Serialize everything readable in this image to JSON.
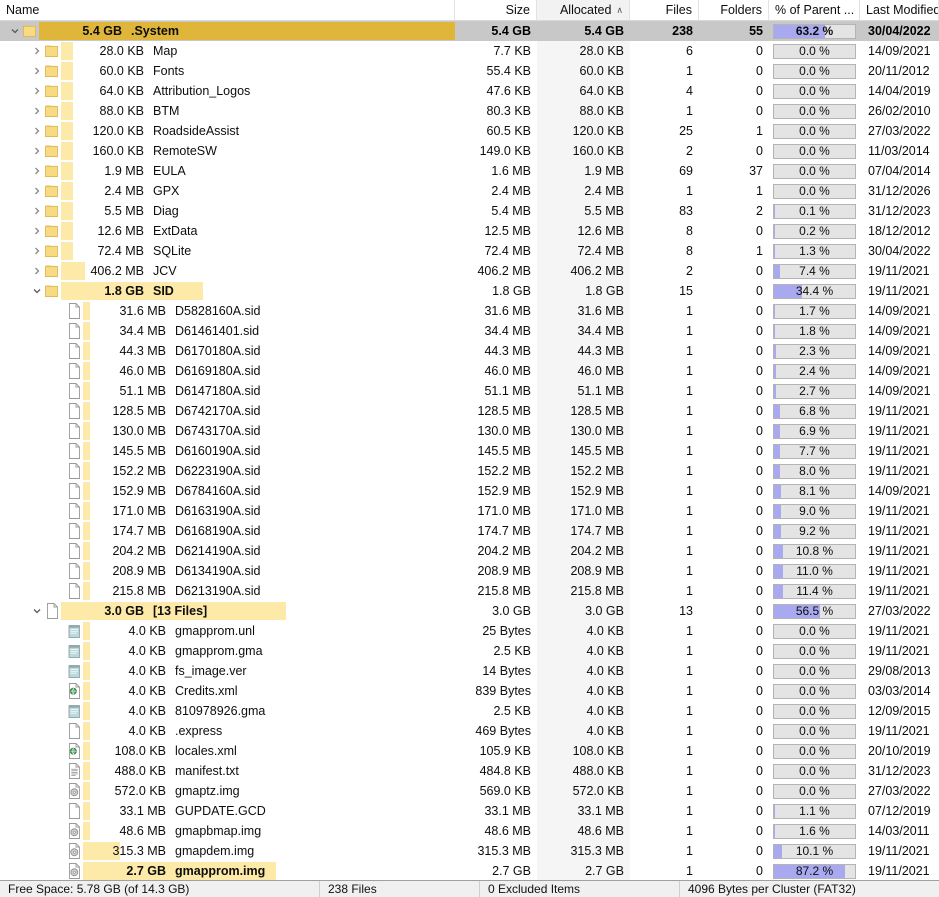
{
  "columns": {
    "name": "Name",
    "size": "Size",
    "allocated": "Allocated",
    "allocated_sort_glyph": "∧",
    "files": "Files",
    "folders": "Folders",
    "percent_of_parent": "% of Parent ...",
    "last_modified": "Last Modified"
  },
  "colors": {
    "size_bar": "#fde9a8",
    "size_bar_selected": "#dfb53a",
    "percent_fill": "#a9a9f0",
    "percent_track": "#e4e4e4",
    "selected_row": "#c8c8c8",
    "folder_icon": "#f6d776",
    "sorted_column": "#f5f5f5"
  },
  "status_bar": [
    "Free Space:  5.78 GB  (of 14.3 GB)",
    "238  Files",
    "0  Excluded Items",
    "4096  Bytes per Cluster  (FAT32)"
  ],
  "rows": [
    {
      "twisty": "expanded",
      "icon": "folder",
      "size_label": "5.4 GB",
      "name": ".System",
      "bar_pct": 100,
      "selected": true,
      "bold": true,
      "size": "5.4 GB",
      "allocated": "5.4 GB",
      "files": "238",
      "folders": "55",
      "percent": "63.2 %",
      "percent_value": 63.2,
      "modified": "30/04/2022",
      "depth": 0
    },
    {
      "twisty": "collapsed",
      "icon": "folder",
      "size_label": "28.0 KB",
      "name": "Map",
      "bar_pct": 3,
      "selected": false,
      "bold": false,
      "size": "7.7 KB",
      "allocated": "28.0 KB",
      "files": "6",
      "folders": "0",
      "percent": "0.0 %",
      "percent_value": 0.0,
      "modified": "14/09/2021",
      "depth": 1
    },
    {
      "twisty": "collapsed",
      "icon": "folder",
      "size_label": "60.0 KB",
      "name": "Fonts",
      "bar_pct": 3,
      "selected": false,
      "bold": false,
      "size": "55.4 KB",
      "allocated": "60.0 KB",
      "files": "1",
      "folders": "0",
      "percent": "0.0 %",
      "percent_value": 0.0,
      "modified": "20/11/2012",
      "depth": 1
    },
    {
      "twisty": "collapsed",
      "icon": "folder",
      "size_label": "64.0 KB",
      "name": "Attribution_Logos",
      "bar_pct": 3,
      "selected": false,
      "bold": false,
      "size": "47.6 KB",
      "allocated": "64.0 KB",
      "files": "4",
      "folders": "0",
      "percent": "0.0 %",
      "percent_value": 0.0,
      "modified": "14/04/2019",
      "depth": 1
    },
    {
      "twisty": "collapsed",
      "icon": "folder",
      "size_label": "88.0 KB",
      "name": "BTM",
      "bar_pct": 3,
      "selected": false,
      "bold": false,
      "size": "80.3 KB",
      "allocated": "88.0 KB",
      "files": "1",
      "folders": "0",
      "percent": "0.0 %",
      "percent_value": 0.0,
      "modified": "26/02/2010",
      "depth": 1
    },
    {
      "twisty": "collapsed",
      "icon": "folder",
      "size_label": "120.0 KB",
      "name": "RoadsideAssist",
      "bar_pct": 3,
      "selected": false,
      "bold": false,
      "size": "60.5 KB",
      "allocated": "120.0 KB",
      "files": "25",
      "folders": "1",
      "percent": "0.0 %",
      "percent_value": 0.0,
      "modified": "27/03/2022",
      "depth": 1
    },
    {
      "twisty": "collapsed",
      "icon": "folder",
      "size_label": "160.0 KB",
      "name": "RemoteSW",
      "bar_pct": 3,
      "selected": false,
      "bold": false,
      "size": "149.0 KB",
      "allocated": "160.0 KB",
      "files": "2",
      "folders": "0",
      "percent": "0.0 %",
      "percent_value": 0.0,
      "modified": "11/03/2014",
      "depth": 1
    },
    {
      "twisty": "collapsed",
      "icon": "folder",
      "size_label": "1.9 MB",
      "name": "EULA",
      "bar_pct": 3,
      "selected": false,
      "bold": false,
      "size": "1.6 MB",
      "allocated": "1.9 MB",
      "files": "69",
      "folders": "37",
      "percent": "0.0 %",
      "percent_value": 0.0,
      "modified": "07/04/2014",
      "depth": 1
    },
    {
      "twisty": "collapsed",
      "icon": "folder",
      "size_label": "2.4 MB",
      "name": "GPX",
      "bar_pct": 3,
      "selected": false,
      "bold": false,
      "size": "2.4 MB",
      "allocated": "2.4 MB",
      "files": "1",
      "folders": "1",
      "percent": "0.0 %",
      "percent_value": 0.0,
      "modified": "31/12/2026",
      "depth": 1
    },
    {
      "twisty": "collapsed",
      "icon": "folder",
      "size_label": "5.5 MB",
      "name": "Diag",
      "bar_pct": 3,
      "selected": false,
      "bold": false,
      "size": "5.4 MB",
      "allocated": "5.5 MB",
      "files": "83",
      "folders": "2",
      "percent": "0.1 %",
      "percent_value": 0.1,
      "modified": "31/12/2023",
      "depth": 1
    },
    {
      "twisty": "collapsed",
      "icon": "folder",
      "size_label": "12.6 MB",
      "name": "ExtData",
      "bar_pct": 3,
      "selected": false,
      "bold": false,
      "size": "12.5 MB",
      "allocated": "12.6 MB",
      "files": "8",
      "folders": "0",
      "percent": "0.2 %",
      "percent_value": 0.2,
      "modified": "18/12/2012",
      "depth": 1
    },
    {
      "twisty": "collapsed",
      "icon": "folder",
      "size_label": "72.4 MB",
      "name": "SQLite",
      "bar_pct": 3,
      "selected": false,
      "bold": false,
      "size": "72.4 MB",
      "allocated": "72.4 MB",
      "files": "8",
      "folders": "1",
      "percent": "1.3 %",
      "percent_value": 1.3,
      "modified": "30/04/2022",
      "depth": 1
    },
    {
      "twisty": "collapsed",
      "icon": "folder",
      "size_label": "406.2 MB",
      "name": "JCV",
      "bar_pct": 6,
      "selected": false,
      "bold": false,
      "size": "406.2 MB",
      "allocated": "406.2 MB",
      "files": "2",
      "folders": "0",
      "percent": "7.4 %",
      "percent_value": 7.4,
      "modified": "19/11/2021",
      "depth": 1
    },
    {
      "twisty": "expanded",
      "icon": "folder",
      "size_label": "1.8 GB",
      "name": "SID",
      "bar_pct": 36,
      "selected": false,
      "bold": true,
      "size": "1.8 GB",
      "allocated": "1.8 GB",
      "files": "15",
      "folders": "0",
      "percent": "34.4 %",
      "percent_value": 34.4,
      "modified": "19/11/2021",
      "depth": 1
    },
    {
      "twisty": "none",
      "icon": "file-plain",
      "size_label": "31.6 MB",
      "name": "D5828160A.sid",
      "bar_pct": 2,
      "selected": false,
      "bold": false,
      "size": "31.6 MB",
      "allocated": "31.6 MB",
      "files": "1",
      "folders": "0",
      "percent": "1.7 %",
      "percent_value": 1.7,
      "modified": "14/09/2021",
      "depth": 2
    },
    {
      "twisty": "none",
      "icon": "file-plain",
      "size_label": "34.4 MB",
      "name": "D61461401.sid",
      "bar_pct": 2,
      "selected": false,
      "bold": false,
      "size": "34.4 MB",
      "allocated": "34.4 MB",
      "files": "1",
      "folders": "0",
      "percent": "1.8 %",
      "percent_value": 1.8,
      "modified": "14/09/2021",
      "depth": 2
    },
    {
      "twisty": "none",
      "icon": "file-plain",
      "size_label": "44.3 MB",
      "name": "D6170180A.sid",
      "bar_pct": 2,
      "selected": false,
      "bold": false,
      "size": "44.3 MB",
      "allocated": "44.3 MB",
      "files": "1",
      "folders": "0",
      "percent": "2.3 %",
      "percent_value": 2.3,
      "modified": "14/09/2021",
      "depth": 2
    },
    {
      "twisty": "none",
      "icon": "file-plain",
      "size_label": "46.0 MB",
      "name": "D6169180A.sid",
      "bar_pct": 2,
      "selected": false,
      "bold": false,
      "size": "46.0 MB",
      "allocated": "46.0 MB",
      "files": "1",
      "folders": "0",
      "percent": "2.4 %",
      "percent_value": 2.4,
      "modified": "14/09/2021",
      "depth": 2
    },
    {
      "twisty": "none",
      "icon": "file-plain",
      "size_label": "51.1 MB",
      "name": "D6147180A.sid",
      "bar_pct": 2,
      "selected": false,
      "bold": false,
      "size": "51.1 MB",
      "allocated": "51.1 MB",
      "files": "1",
      "folders": "0",
      "percent": "2.7 %",
      "percent_value": 2.7,
      "modified": "14/09/2021",
      "depth": 2
    },
    {
      "twisty": "none",
      "icon": "file-plain",
      "size_label": "128.5 MB",
      "name": "D6742170A.sid",
      "bar_pct": 2,
      "selected": false,
      "bold": false,
      "size": "128.5 MB",
      "allocated": "128.5 MB",
      "files": "1",
      "folders": "0",
      "percent": "6.8 %",
      "percent_value": 6.8,
      "modified": "19/11/2021",
      "depth": 2
    },
    {
      "twisty": "none",
      "icon": "file-plain",
      "size_label": "130.0 MB",
      "name": "D6743170A.sid",
      "bar_pct": 2,
      "selected": false,
      "bold": false,
      "size": "130.0 MB",
      "allocated": "130.0 MB",
      "files": "1",
      "folders": "0",
      "percent": "6.9 %",
      "percent_value": 6.9,
      "modified": "19/11/2021",
      "depth": 2
    },
    {
      "twisty": "none",
      "icon": "file-plain",
      "size_label": "145.5 MB",
      "name": "D6160190A.sid",
      "bar_pct": 2,
      "selected": false,
      "bold": false,
      "size": "145.5 MB",
      "allocated": "145.5 MB",
      "files": "1",
      "folders": "0",
      "percent": "7.7 %",
      "percent_value": 7.7,
      "modified": "19/11/2021",
      "depth": 2
    },
    {
      "twisty": "none",
      "icon": "file-plain",
      "size_label": "152.2 MB",
      "name": "D6223190A.sid",
      "bar_pct": 2,
      "selected": false,
      "bold": false,
      "size": "152.2 MB",
      "allocated": "152.2 MB",
      "files": "1",
      "folders": "0",
      "percent": "8.0 %",
      "percent_value": 8.0,
      "modified": "19/11/2021",
      "depth": 2
    },
    {
      "twisty": "none",
      "icon": "file-plain",
      "size_label": "152.9 MB",
      "name": "D6784160A.sid",
      "bar_pct": 2,
      "selected": false,
      "bold": false,
      "size": "152.9 MB",
      "allocated": "152.9 MB",
      "files": "1",
      "folders": "0",
      "percent": "8.1 %",
      "percent_value": 8.1,
      "modified": "14/09/2021",
      "depth": 2
    },
    {
      "twisty": "none",
      "icon": "file-plain",
      "size_label": "171.0 MB",
      "name": "D6163190A.sid",
      "bar_pct": 2,
      "selected": false,
      "bold": false,
      "size": "171.0 MB",
      "allocated": "171.0 MB",
      "files": "1",
      "folders": "0",
      "percent": "9.0 %",
      "percent_value": 9.0,
      "modified": "19/11/2021",
      "depth": 2
    },
    {
      "twisty": "none",
      "icon": "file-plain",
      "size_label": "174.7 MB",
      "name": "D6168190A.sid",
      "bar_pct": 2,
      "selected": false,
      "bold": false,
      "size": "174.7 MB",
      "allocated": "174.7 MB",
      "files": "1",
      "folders": "0",
      "percent": "9.2 %",
      "percent_value": 9.2,
      "modified": "19/11/2021",
      "depth": 2
    },
    {
      "twisty": "none",
      "icon": "file-plain",
      "size_label": "204.2 MB",
      "name": "D6214190A.sid",
      "bar_pct": 2,
      "selected": false,
      "bold": false,
      "size": "204.2 MB",
      "allocated": "204.2 MB",
      "files": "1",
      "folders": "0",
      "percent": "10.8 %",
      "percent_value": 10.8,
      "modified": "19/11/2021",
      "depth": 2
    },
    {
      "twisty": "none",
      "icon": "file-plain",
      "size_label": "208.9 MB",
      "name": "D6134190A.sid",
      "bar_pct": 2,
      "selected": false,
      "bold": false,
      "size": "208.9 MB",
      "allocated": "208.9 MB",
      "files": "1",
      "folders": "0",
      "percent": "11.0 %",
      "percent_value": 11.0,
      "modified": "19/11/2021",
      "depth": 2
    },
    {
      "twisty": "none",
      "icon": "file-plain",
      "size_label": "215.8 MB",
      "name": "D6213190A.sid",
      "bar_pct": 2,
      "selected": false,
      "bold": false,
      "size": "215.8 MB",
      "allocated": "215.8 MB",
      "files": "1",
      "folders": "0",
      "percent": "11.4 %",
      "percent_value": 11.4,
      "modified": "19/11/2021",
      "depth": 2
    },
    {
      "twisty": "expanded",
      "icon": "file-plain",
      "size_label": "3.0 GB",
      "name": "[13 Files]",
      "bar_pct": 57,
      "selected": false,
      "bold": true,
      "size": "3.0 GB",
      "allocated": "3.0 GB",
      "files": "13",
      "folders": "0",
      "percent": "56.5 %",
      "percent_value": 56.5,
      "modified": "27/03/2022",
      "depth": 1
    },
    {
      "twisty": "none",
      "icon": "file-notepad",
      "size_label": "4.0 KB",
      "name": "gmapprom.unl",
      "bar_pct": 2,
      "selected": false,
      "bold": false,
      "size": "25 Bytes",
      "allocated": "4.0 KB",
      "files": "1",
      "folders": "0",
      "percent": "0.0 %",
      "percent_value": 0.0,
      "modified": "19/11/2021",
      "depth": 2
    },
    {
      "twisty": "none",
      "icon": "file-notepad",
      "size_label": "4.0 KB",
      "name": "gmapprom.gma",
      "bar_pct": 2,
      "selected": false,
      "bold": false,
      "size": "2.5 KB",
      "allocated": "4.0 KB",
      "files": "1",
      "folders": "0",
      "percent": "0.0 %",
      "percent_value": 0.0,
      "modified": "19/11/2021",
      "depth": 2
    },
    {
      "twisty": "none",
      "icon": "file-notepad",
      "size_label": "4.0 KB",
      "name": "fs_image.ver",
      "bar_pct": 2,
      "selected": false,
      "bold": false,
      "size": "14 Bytes",
      "allocated": "4.0 KB",
      "files": "1",
      "folders": "0",
      "percent": "0.0 %",
      "percent_value": 0.0,
      "modified": "29/08/2013",
      "depth": 2
    },
    {
      "twisty": "none",
      "icon": "file-xml",
      "size_label": "4.0 KB",
      "name": "Credits.xml",
      "bar_pct": 2,
      "selected": false,
      "bold": false,
      "size": "839 Bytes",
      "allocated": "4.0 KB",
      "files": "1",
      "folders": "0",
      "percent": "0.0 %",
      "percent_value": 0.0,
      "modified": "03/03/2014",
      "depth": 2
    },
    {
      "twisty": "none",
      "icon": "file-notepad",
      "size_label": "4.0 KB",
      "name": "810978926.gma",
      "bar_pct": 2,
      "selected": false,
      "bold": false,
      "size": "2.5 KB",
      "allocated": "4.0 KB",
      "files": "1",
      "folders": "0",
      "percent": "0.0 %",
      "percent_value": 0.0,
      "modified": "12/09/2015",
      "depth": 2
    },
    {
      "twisty": "none",
      "icon": "file-plain",
      "size_label": "4.0 KB",
      "name": ".express",
      "bar_pct": 2,
      "selected": false,
      "bold": false,
      "size": "469 Bytes",
      "allocated": "4.0 KB",
      "files": "1",
      "folders": "0",
      "percent": "0.0 %",
      "percent_value": 0.0,
      "modified": "19/11/2021",
      "depth": 2
    },
    {
      "twisty": "none",
      "icon": "file-xml",
      "size_label": "108.0 KB",
      "name": "locales.xml",
      "bar_pct": 2,
      "selected": false,
      "bold": false,
      "size": "105.9 KB",
      "allocated": "108.0 KB",
      "files": "1",
      "folders": "0",
      "percent": "0.0 %",
      "percent_value": 0.0,
      "modified": "20/10/2019",
      "depth": 2
    },
    {
      "twisty": "none",
      "icon": "file-text",
      "size_label": "488.0 KB",
      "name": "manifest.txt",
      "bar_pct": 2,
      "selected": false,
      "bold": false,
      "size": "484.8 KB",
      "allocated": "488.0 KB",
      "files": "1",
      "folders": "0",
      "percent": "0.0 %",
      "percent_value": 0.0,
      "modified": "31/12/2023",
      "depth": 2
    },
    {
      "twisty": "none",
      "icon": "file-img",
      "size_label": "572.0 KB",
      "name": "gmaptz.img",
      "bar_pct": 2,
      "selected": false,
      "bold": false,
      "size": "569.0 KB",
      "allocated": "572.0 KB",
      "files": "1",
      "folders": "0",
      "percent": "0.0 %",
      "percent_value": 0.0,
      "modified": "27/03/2022",
      "depth": 2
    },
    {
      "twisty": "none",
      "icon": "file-plain",
      "size_label": "33.1 MB",
      "name": "GUPDATE.GCD",
      "bar_pct": 2,
      "selected": false,
      "bold": false,
      "size": "33.1 MB",
      "allocated": "33.1 MB",
      "files": "1",
      "folders": "0",
      "percent": "1.1 %",
      "percent_value": 1.1,
      "modified": "07/12/2019",
      "depth": 2
    },
    {
      "twisty": "none",
      "icon": "file-img",
      "size_label": "48.6 MB",
      "name": "gmapbmap.img",
      "bar_pct": 2,
      "selected": false,
      "bold": false,
      "size": "48.6 MB",
      "allocated": "48.6 MB",
      "files": "1",
      "folders": "0",
      "percent": "1.6 %",
      "percent_value": 1.6,
      "modified": "14/03/2011",
      "depth": 2
    },
    {
      "twisty": "none",
      "icon": "file-img",
      "size_label": "315.3 MB",
      "name": "gmapdem.img",
      "bar_pct": 10,
      "selected": false,
      "bold": false,
      "size": "315.3 MB",
      "allocated": "315.3 MB",
      "files": "1",
      "folders": "0",
      "percent": "10.1 %",
      "percent_value": 10.1,
      "modified": "19/11/2021",
      "depth": 2
    },
    {
      "twisty": "none",
      "icon": "file-img",
      "size_label": "2.7 GB",
      "name": "gmapprom.img",
      "bar_pct": 52,
      "selected": false,
      "bold": true,
      "size": "2.7 GB",
      "allocated": "2.7 GB",
      "files": "1",
      "folders": "0",
      "percent": "87.2 %",
      "percent_value": 87.2,
      "modified": "19/11/2021",
      "depth": 2
    }
  ]
}
